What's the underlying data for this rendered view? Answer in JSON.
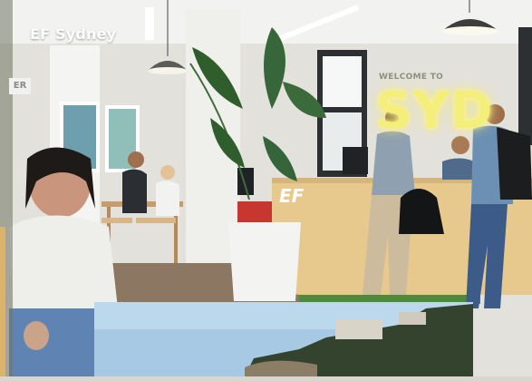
{
  "photo": {
    "caption": "EF Sydney",
    "wall_sign": "ER",
    "welcome_text": "WELCOME TO",
    "neon_text": "SYD",
    "desk_logo": "EF"
  },
  "colors": {
    "neon": "#f4ee7a",
    "desk": "#e7c98e",
    "floor_mat": "#4f8a3b",
    "ocean_sky": "#9fc5e2"
  }
}
